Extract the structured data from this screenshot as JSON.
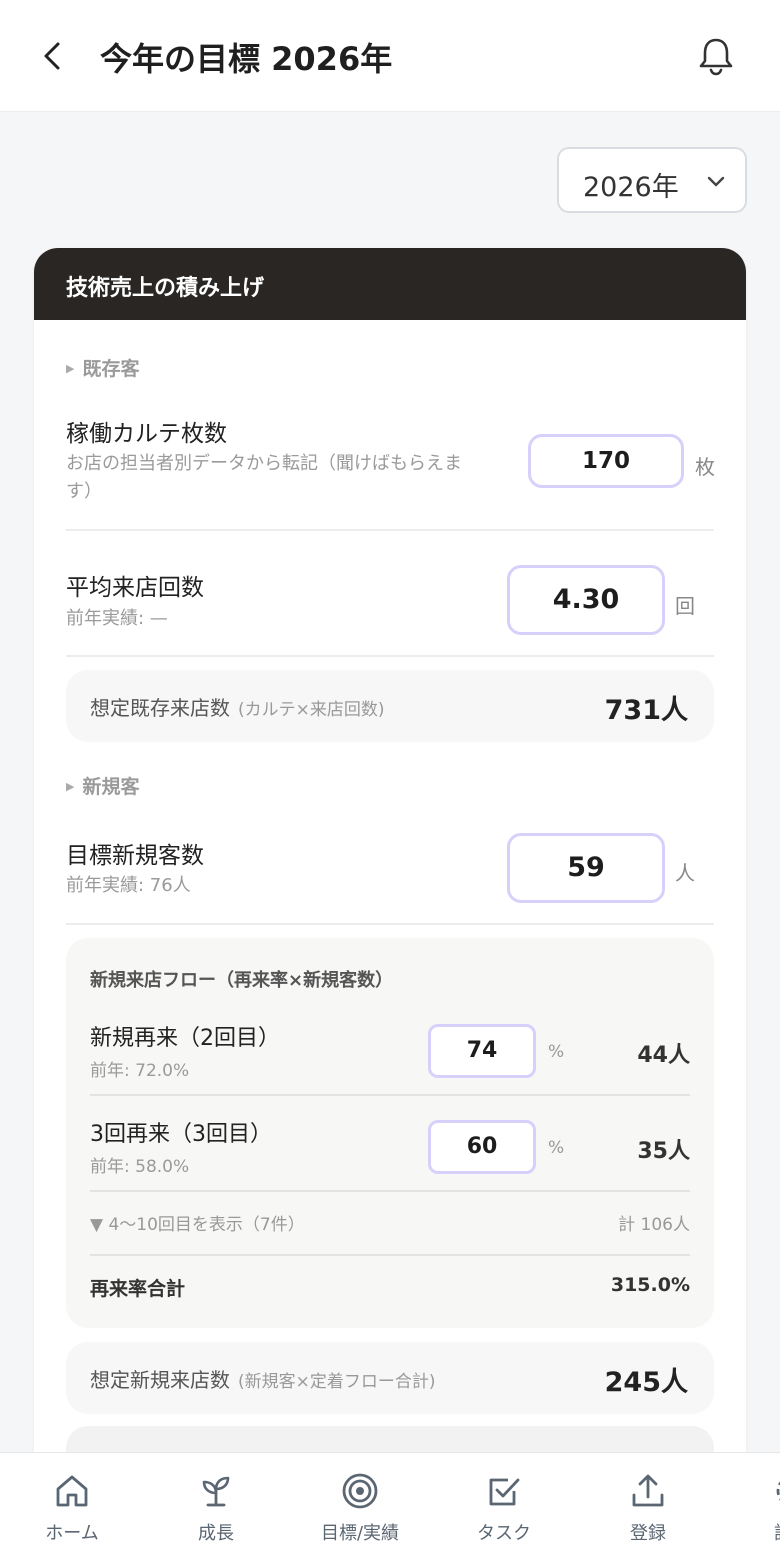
{
  "header": {
    "title": "今年の目標 2026年"
  },
  "year_select": {
    "value": "2026年"
  },
  "card": {
    "title": "技術売上の積み上げ",
    "existing": {
      "section": "既存客",
      "karte": {
        "label": "稼働カルテ枚数",
        "sub1": "お店の担当者別データから転記（聞けばもらえま",
        "sub2": "す）",
        "value": "170",
        "unit": "枚"
      },
      "visits": {
        "label": "平均来店回数",
        "sub": "前年実績: —",
        "value": "4.30",
        "unit": "回"
      },
      "summary": {
        "label": "想定既存来店数",
        "note": "(カルテ×来店回数)",
        "value": "731人"
      }
    },
    "new": {
      "section": "新規客",
      "target": {
        "label": "目標新規客数",
        "sub": "前年実績: 76人",
        "value": "59",
        "unit": "人"
      },
      "flow": {
        "title": "新規来店フロー（再来率×新規客数）",
        "rows": [
          {
            "label": "新規再来（2回目）",
            "sub": "前年: 72.0%",
            "value": "74",
            "pct": "%",
            "result": "44人"
          },
          {
            "label": "3回再来（3回目）",
            "sub": "前年: 58.0%",
            "value": "60",
            "pct": "%",
            "result": "35人"
          }
        ],
        "more": "▼ 4〜10回目を表示（7件）",
        "more_total": "計 106人",
        "total_label": "再来率合計",
        "total_value": "315.0%"
      },
      "summary": {
        "label": "想定新規来店数",
        "note": "(新規客×定着フロー合計)",
        "value": "245人"
      }
    }
  },
  "nav": [
    {
      "label": "ホーム",
      "icon": "home-icon"
    },
    {
      "label": "成長",
      "icon": "sprout-icon"
    },
    {
      "label": "目標/実績",
      "icon": "target-icon"
    },
    {
      "label": "タスク",
      "icon": "checkbox-icon"
    },
    {
      "label": "登録",
      "icon": "upload-icon"
    },
    {
      "label": "設定",
      "icon": "settings-icon"
    }
  ]
}
